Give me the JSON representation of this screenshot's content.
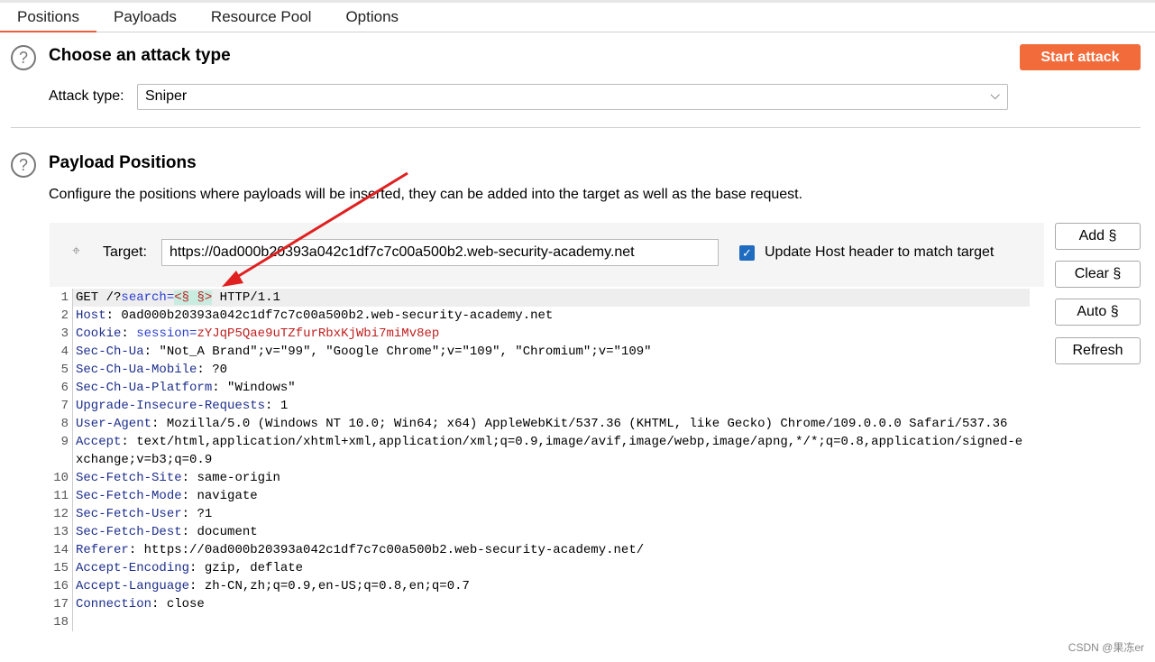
{
  "tabs": [
    {
      "label": "Positions",
      "active": true
    },
    {
      "label": "Payloads"
    },
    {
      "label": "Resource Pool"
    },
    {
      "label": "Options"
    }
  ],
  "attack": {
    "title": "Choose an attack type",
    "start_label": "Start attack",
    "type_label": "Attack type:",
    "type_value": "Sniper"
  },
  "positions": {
    "title": "Payload Positions",
    "description": "Configure the positions where payloads will be inserted, they can be added into the target as well as the base request.",
    "target_label": "Target:",
    "target_value": "https://0ad000b20393a042c1df7c7c00a500b2.web-security-academy.net",
    "update_host_label": "Update Host header to match target",
    "update_host_checked": true,
    "buttons": [
      "Add §",
      "Clear §",
      "Auto §",
      "Refresh"
    ]
  },
  "request": {
    "line1": {
      "method": "GET /?",
      "param": "search",
      "eq": "=",
      "marker": "§ §",
      "rest": " HTTP/1.1"
    },
    "cookie": {
      "name": "Cookie",
      "param": "session",
      "value": "zYJqP5Qae9uTZfurRbxKjWbi7miMv8ep"
    },
    "headers": [
      {
        "n": 2,
        "name": "Host",
        "value": "0ad000b20393a042c1df7c7c00a500b2.web-security-academy.net"
      },
      {
        "n": 4,
        "name": "Sec-Ch-Ua",
        "value": "\"Not_A Brand\";v=\"99\", \"Google Chrome\";v=\"109\", \"Chromium\";v=\"109\""
      },
      {
        "n": 5,
        "name": "Sec-Ch-Ua-Mobile",
        "value": "?0"
      },
      {
        "n": 6,
        "name": "Sec-Ch-Ua-Platform",
        "value": "\"Windows\""
      },
      {
        "n": 7,
        "name": "Upgrade-Insecure-Requests",
        "value": "1"
      },
      {
        "n": 8,
        "name": "User-Agent",
        "value": "Mozilla/5.0 (Windows NT 10.0; Win64; x64) AppleWebKit/537.36 (KHTML, like Gecko) Chrome/109.0.0.0 Safari/537.36"
      },
      {
        "n": 9,
        "name": "Accept",
        "value": "text/html,application/xhtml+xml,application/xml;q=0.9,image/avif,image/webp,image/apng,*/*;q=0.8,application/signed-exchange;v=b3;q=0.9"
      },
      {
        "n": 10,
        "name": "Sec-Fetch-Site",
        "value": "same-origin"
      },
      {
        "n": 11,
        "name": "Sec-Fetch-Mode",
        "value": "navigate"
      },
      {
        "n": 12,
        "name": "Sec-Fetch-User",
        "value": "?1"
      },
      {
        "n": 13,
        "name": "Sec-Fetch-Dest",
        "value": "document"
      },
      {
        "n": 14,
        "name": "Referer",
        "value": "https://0ad000b20393a042c1df7c7c00a500b2.web-security-academy.net/"
      },
      {
        "n": 15,
        "name": "Accept-Encoding",
        "value": "gzip, deflate"
      },
      {
        "n": 16,
        "name": "Accept-Language",
        "value": "zh-CN,zh;q=0.9,en-US;q=0.8,en;q=0.7"
      },
      {
        "n": 17,
        "name": "Connection",
        "value": "close"
      }
    ]
  },
  "watermark": "CSDN @果冻er",
  "colors": {
    "accent": "#f26b3a",
    "header_name": "#1d2f8c",
    "param": "#2b3ed1",
    "value_red": "#c02020",
    "arrow": "#e02020"
  }
}
